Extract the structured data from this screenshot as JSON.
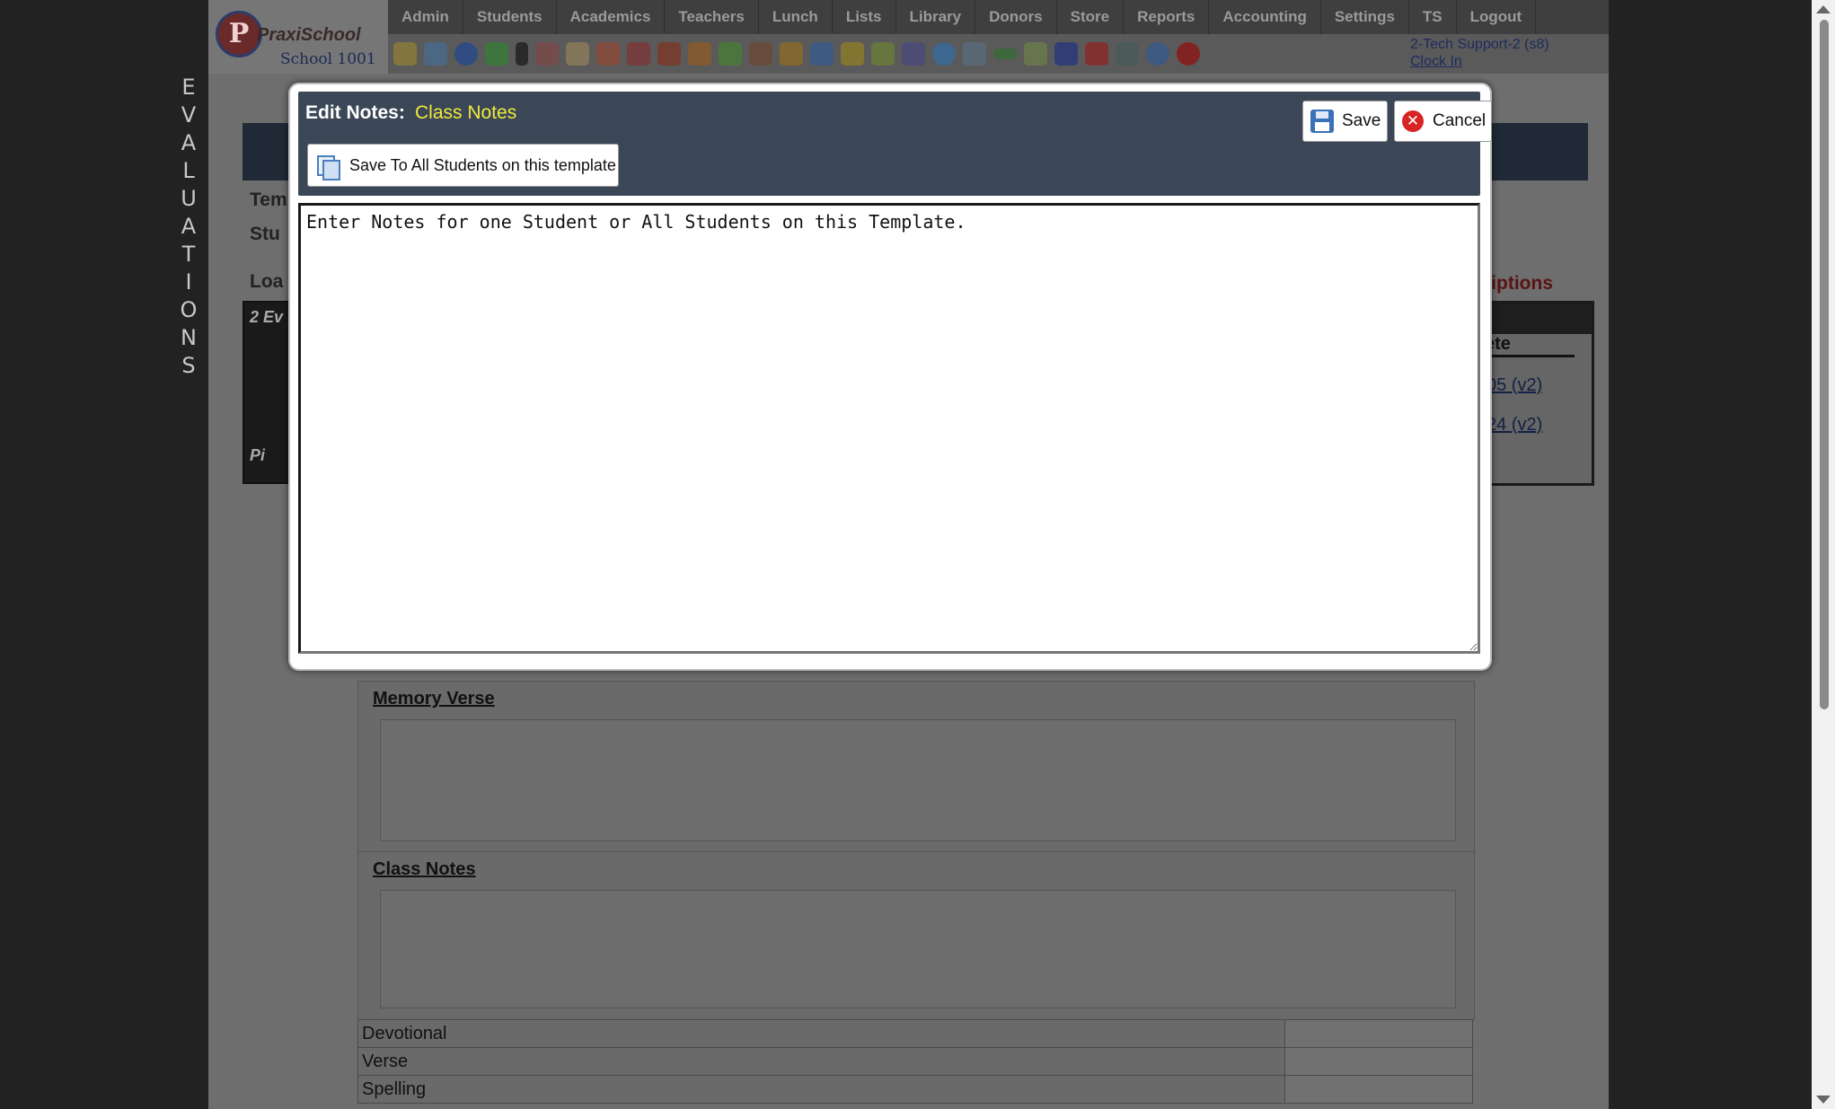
{
  "app": {
    "logo_text": "PraxiSchool",
    "logo_letter": "P",
    "school_name": "School 1001"
  },
  "nav": {
    "items": [
      "Admin",
      "Students",
      "Academics",
      "Teachers",
      "Lunch",
      "Lists",
      "Library",
      "Donors",
      "Store",
      "Reports",
      "Accounting",
      "Settings",
      "TS",
      "Logout"
    ]
  },
  "user": {
    "name": "2-Tech Support-2 (s8)",
    "clock_in": "Clock In"
  },
  "sidebar": {
    "vertical_title": "EVALUATIONS"
  },
  "background": {
    "label_tem": "Tem",
    "label_stu": "Stu",
    "label_load": "Loa",
    "photo_caption": "2 Ev",
    "photo_caption_2": "Pi",
    "link_descriptions": "riptions",
    "panel_header": "ete",
    "panel_link_1": "05 (v2)",
    "panel_link_2": "24 (v2)",
    "sections": [
      {
        "title": "Memory Verse"
      },
      {
        "title": "Class Notes"
      }
    ],
    "grade_rows": [
      "Devotional",
      "Verse",
      "Spelling"
    ]
  },
  "modal": {
    "title": "Edit Notes:",
    "subtitle": "Class Notes",
    "save_label": "Save",
    "cancel_label": "Cancel",
    "save_all_label": "Save To All Students on this template",
    "notes_placeholder": "Enter Notes for one Student or All Students on this Template."
  },
  "colors": {
    "modal_header": "#3b4756",
    "subtitle": "#f2ea3a",
    "cancel_icon": "#d82424",
    "save_icon": "#3a71b8"
  }
}
